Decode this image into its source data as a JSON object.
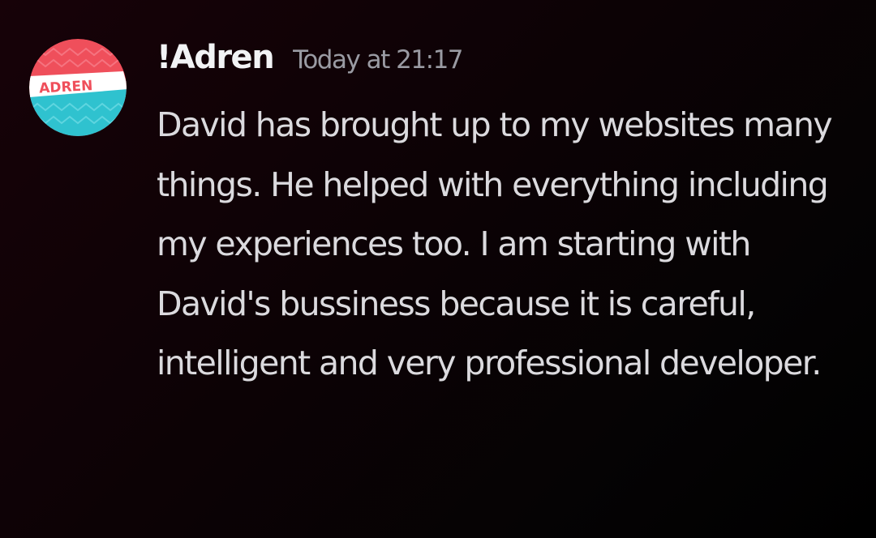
{
  "message": {
    "author": "!Adren",
    "timestamp": "Today at 21:17",
    "avatar": {
      "label": "ADREN",
      "colors": {
        "top": "#ef4f5b",
        "band": "#2fc2cf",
        "label_bg": "#ffffff",
        "label_text": "#ef4f5b"
      }
    },
    "text": "David has brought up to my websites many things. He helped with everything including my experiences too. I am starting with David's bussiness because it is careful, intelligent and very professional developer."
  },
  "theme": {
    "background": "#0c0205",
    "username_color": "#f2f3f5",
    "timestamp_color": "#9a9ba3",
    "text_color": "#dbdade"
  }
}
